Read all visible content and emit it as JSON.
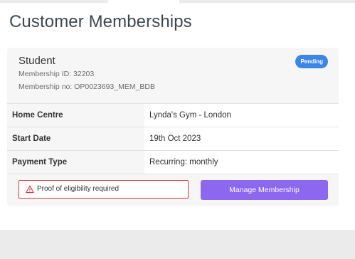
{
  "page": {
    "title": "Customer Memberships"
  },
  "membership": {
    "name": "Student",
    "status": "Pending",
    "id_text": "Membership ID: 32203",
    "number_text": "Membership no: OP0023693_MEM_BDB",
    "details": [
      {
        "label": "Home Centre",
        "value": "Lynda's Gym - London"
      },
      {
        "label": "Start Date",
        "value": "19th Oct 2023"
      },
      {
        "label": "Payment Type",
        "value": "Recurring: monthly"
      }
    ],
    "warning": {
      "icon": "warning-triangle-icon",
      "text": "Proof of eligibility required"
    },
    "action_label": "Manage Membership"
  },
  "colors": {
    "status_badge": "#3d86e8",
    "action_button": "#8c67ef",
    "warning_border": "#d9363e"
  }
}
